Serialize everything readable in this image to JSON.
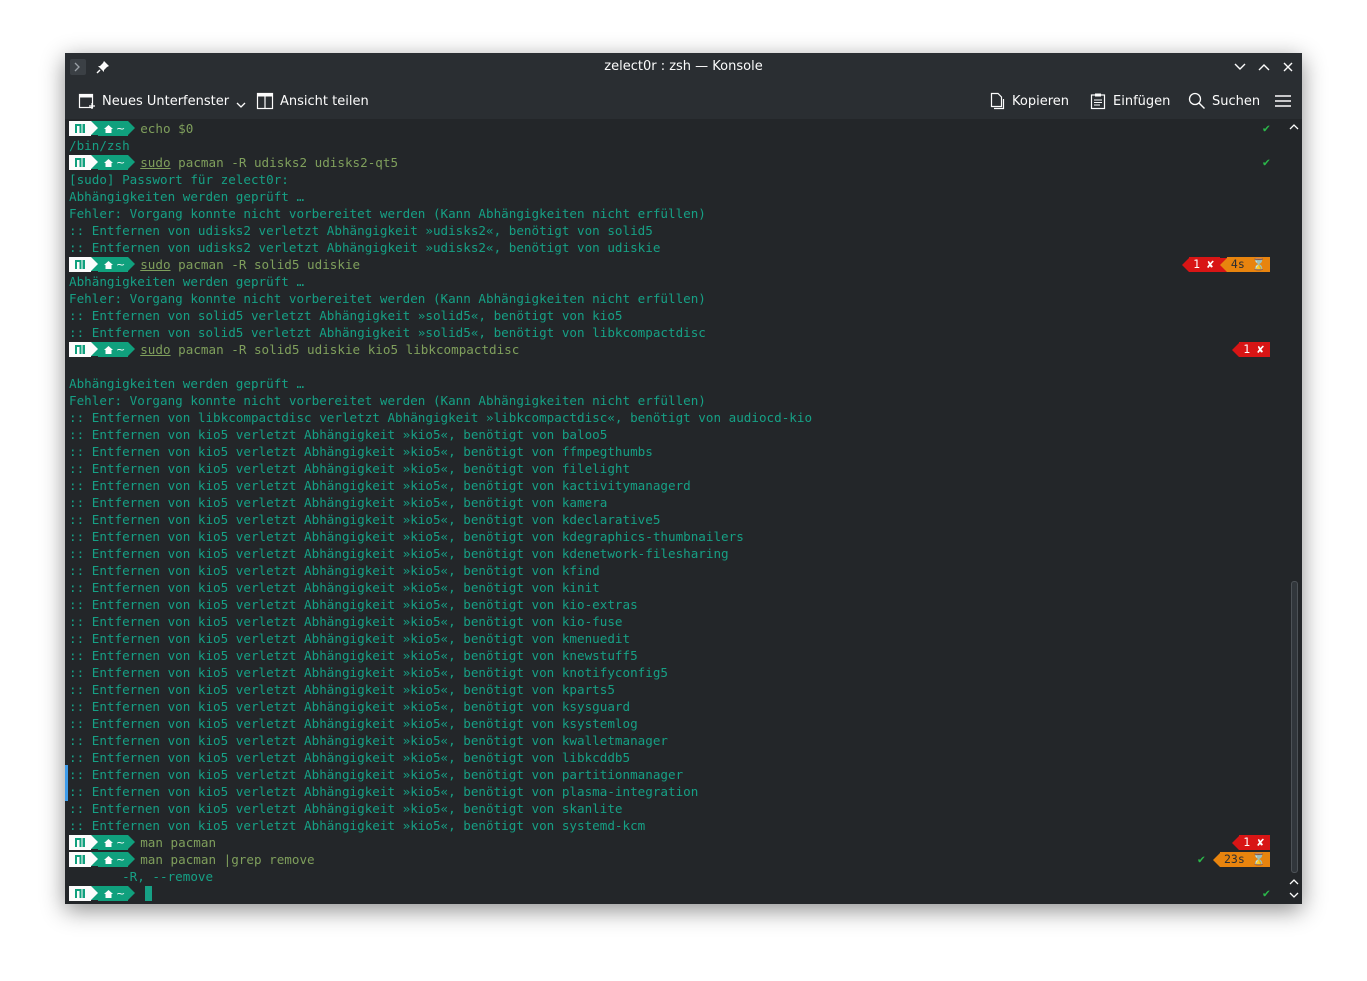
{
  "window": {
    "title": "zelect0r : zsh — Konsole",
    "icons": {
      "app": "konsole-icon",
      "pin": "pin-icon",
      "minimize": "chevron-down-icon",
      "maximize": "chevron-up-icon",
      "close": "close-icon"
    }
  },
  "toolbar": {
    "new_tab_label": "Neues Unterfenster",
    "split_view_label": "Ansicht teilen",
    "copy_label": "Kopieren",
    "paste_label": "Einfügen",
    "search_label": "Suchen"
  },
  "prompt": {
    "dir": "~"
  },
  "colors": {
    "background": "#232629",
    "output": "#16a085",
    "command": "#7f9f5c",
    "prompt_segment": "#10a07d",
    "error": "#d81515",
    "timer": "#e8840e",
    "ok": "#2bb84a"
  },
  "terminal": {
    "lines": [
      {
        "type": "prompt",
        "cmd": "echo $0",
        "status": "ok"
      },
      {
        "type": "out",
        "text": "/bin/zsh"
      },
      {
        "type": "prompt",
        "cmd_sudo": "sudo",
        "cmd": "pacman -R udisks2 udisks2-qt5",
        "status": "ok"
      },
      {
        "type": "out",
        "text": "[sudo] Passwort für zelect0r:"
      },
      {
        "type": "out",
        "text": "Abhängigkeiten werden geprüft …"
      },
      {
        "type": "out",
        "text": "Fehler: Vorgang konnte nicht vorbereitet werden (Kann Abhängigkeiten nicht erfüllen)"
      },
      {
        "type": "out",
        "text": ":: Entfernen von udisks2 verletzt Abhängigkeit »udisks2«, benötigt von solid5"
      },
      {
        "type": "out",
        "text": ":: Entfernen von udisks2 verletzt Abhängigkeit »udisks2«, benötigt von udiskie"
      },
      {
        "type": "prompt",
        "cmd_sudo": "sudo",
        "cmd": "pacman -R solid5 udiskie",
        "status": "err",
        "err": "1 ✘",
        "time": "4s ⌛"
      },
      {
        "type": "out",
        "text": "Abhängigkeiten werden geprüft …"
      },
      {
        "type": "out",
        "text": "Fehler: Vorgang konnte nicht vorbereitet werden (Kann Abhängigkeiten nicht erfüllen)"
      },
      {
        "type": "out",
        "text": ":: Entfernen von solid5 verletzt Abhängigkeit »solid5«, benötigt von kio5"
      },
      {
        "type": "out",
        "text": ":: Entfernen von solid5 verletzt Abhängigkeit »solid5«, benötigt von libkcompactdisc"
      },
      {
        "type": "prompt",
        "cmd_sudo": "sudo",
        "cmd": "pacman -R solid5 udiskie kio5 libkcompactdisc",
        "status": "err",
        "err": "1 ✘"
      },
      {
        "type": "out",
        "text": ""
      },
      {
        "type": "out",
        "text": "Abhängigkeiten werden geprüft …"
      },
      {
        "type": "out",
        "text": "Fehler: Vorgang konnte nicht vorbereitet werden (Kann Abhängigkeiten nicht erfüllen)"
      },
      {
        "type": "out",
        "text": ":: Entfernen von libkcompactdisc verletzt Abhängigkeit »libkcompactdisc«, benötigt von audiocd-kio"
      },
      {
        "type": "out",
        "text": ":: Entfernen von kio5 verletzt Abhängigkeit »kio5«, benötigt von baloo5"
      },
      {
        "type": "out",
        "text": ":: Entfernen von kio5 verletzt Abhängigkeit »kio5«, benötigt von ffmpegthumbs"
      },
      {
        "type": "out",
        "text": ":: Entfernen von kio5 verletzt Abhängigkeit »kio5«, benötigt von filelight"
      },
      {
        "type": "out",
        "text": ":: Entfernen von kio5 verletzt Abhängigkeit »kio5«, benötigt von kactivitymanagerd"
      },
      {
        "type": "out",
        "text": ":: Entfernen von kio5 verletzt Abhängigkeit »kio5«, benötigt von kamera"
      },
      {
        "type": "out",
        "text": ":: Entfernen von kio5 verletzt Abhängigkeit »kio5«, benötigt von kdeclarative5"
      },
      {
        "type": "out",
        "text": ":: Entfernen von kio5 verletzt Abhängigkeit »kio5«, benötigt von kdegraphics-thumbnailers"
      },
      {
        "type": "out",
        "text": ":: Entfernen von kio5 verletzt Abhängigkeit »kio5«, benötigt von kdenetwork-filesharing"
      },
      {
        "type": "out",
        "text": ":: Entfernen von kio5 verletzt Abhängigkeit »kio5«, benötigt von kfind"
      },
      {
        "type": "out",
        "text": ":: Entfernen von kio5 verletzt Abhängigkeit »kio5«, benötigt von kinit"
      },
      {
        "type": "out",
        "text": ":: Entfernen von kio5 verletzt Abhängigkeit »kio5«, benötigt von kio-extras"
      },
      {
        "type": "out",
        "text": ":: Entfernen von kio5 verletzt Abhängigkeit »kio5«, benötigt von kio-fuse"
      },
      {
        "type": "out",
        "text": ":: Entfernen von kio5 verletzt Abhängigkeit »kio5«, benötigt von kmenuedit"
      },
      {
        "type": "out",
        "text": ":: Entfernen von kio5 verletzt Abhängigkeit »kio5«, benötigt von knewstuff5"
      },
      {
        "type": "out",
        "text": ":: Entfernen von kio5 verletzt Abhängigkeit »kio5«, benötigt von knotifyconfig5"
      },
      {
        "type": "out",
        "text": ":: Entfernen von kio5 verletzt Abhängigkeit »kio5«, benötigt von kparts5"
      },
      {
        "type": "out",
        "text": ":: Entfernen von kio5 verletzt Abhängigkeit »kio5«, benötigt von ksysguard"
      },
      {
        "type": "out",
        "text": ":: Entfernen von kio5 verletzt Abhängigkeit »kio5«, benötigt von ksystemlog"
      },
      {
        "type": "out",
        "text": ":: Entfernen von kio5 verletzt Abhängigkeit »kio5«, benötigt von kwalletmanager"
      },
      {
        "type": "out",
        "text": ":: Entfernen von kio5 verletzt Abhängigkeit »kio5«, benötigt von libkcddb5"
      },
      {
        "type": "out",
        "text": ":: Entfernen von kio5 verletzt Abhängigkeit »kio5«, benötigt von partitionmanager"
      },
      {
        "type": "out",
        "text": ":: Entfernen von kio5 verletzt Abhängigkeit »kio5«, benötigt von plasma-integration"
      },
      {
        "type": "out",
        "text": ":: Entfernen von kio5 verletzt Abhängigkeit »kio5«, benötigt von skanlite"
      },
      {
        "type": "out",
        "text": ":: Entfernen von kio5 verletzt Abhängigkeit »kio5«, benötigt von systemd-kcm"
      },
      {
        "type": "prompt",
        "cmd": "man pacman",
        "status": "err",
        "err": "1 ✘"
      },
      {
        "type": "prompt",
        "cmd": "man pacman |grep remove",
        "status": "ok_time",
        "time": "23s ⌛"
      },
      {
        "type": "out",
        "text": "       -R, --remove"
      },
      {
        "type": "prompt",
        "cmd": "",
        "status": "ok",
        "cursor": true
      }
    ]
  }
}
